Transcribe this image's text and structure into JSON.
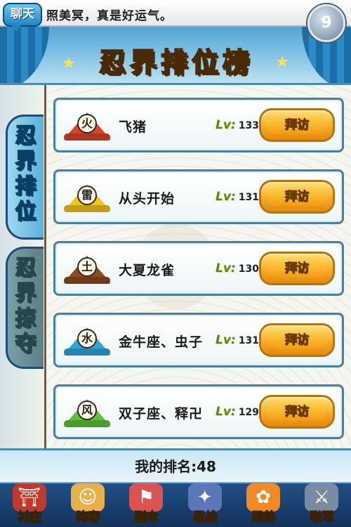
{
  "chat": {
    "badge": "聊天",
    "message": "照美冥，真是好运气。"
  },
  "home_button": {
    "label": "9"
  },
  "title": "忍界排位榜",
  "side_tabs": [
    {
      "label": "忍界排位",
      "active": true
    },
    {
      "label": "忍界掠夺",
      "active": false
    }
  ],
  "rankings": [
    {
      "element": "火",
      "name": "飞猪",
      "level_label": "Lv:",
      "level": "133",
      "visit_label": "拜访",
      "color": "#d9452a"
    },
    {
      "element": "雷",
      "name": "从头开始",
      "level_label": "Lv:",
      "level": "131",
      "visit_label": "拜访",
      "color": "#f2c51c"
    },
    {
      "element": "土",
      "name": "大夏龙雀",
      "level_label": "Lv:",
      "level": "130",
      "visit_label": "拜访",
      "color": "#8b4a1e"
    },
    {
      "element": "水",
      "name": "金牛座、虫子",
      "level_label": "Lv:",
      "level": "131",
      "visit_label": "拜访",
      "color": "#2fa6d9"
    },
    {
      "element": "风",
      "name": "双子座、释卍",
      "level_label": "Lv:",
      "level": "129",
      "visit_label": "拜访",
      "color": "#5cc23a"
    }
  ],
  "my_rank": {
    "label": "我的排名:",
    "value": "48"
  },
  "nav": [
    {
      "label": "村庄",
      "icon": "village-icon"
    },
    {
      "label": "阵容",
      "icon": "team-icon"
    },
    {
      "label": "副本",
      "icon": "scroll-icon"
    },
    {
      "label": "忍战",
      "icon": "shuriken-icon"
    },
    {
      "label": "尾兽",
      "icon": "fox-icon"
    },
    {
      "label": "联军",
      "icon": "alliance-icon"
    }
  ]
}
